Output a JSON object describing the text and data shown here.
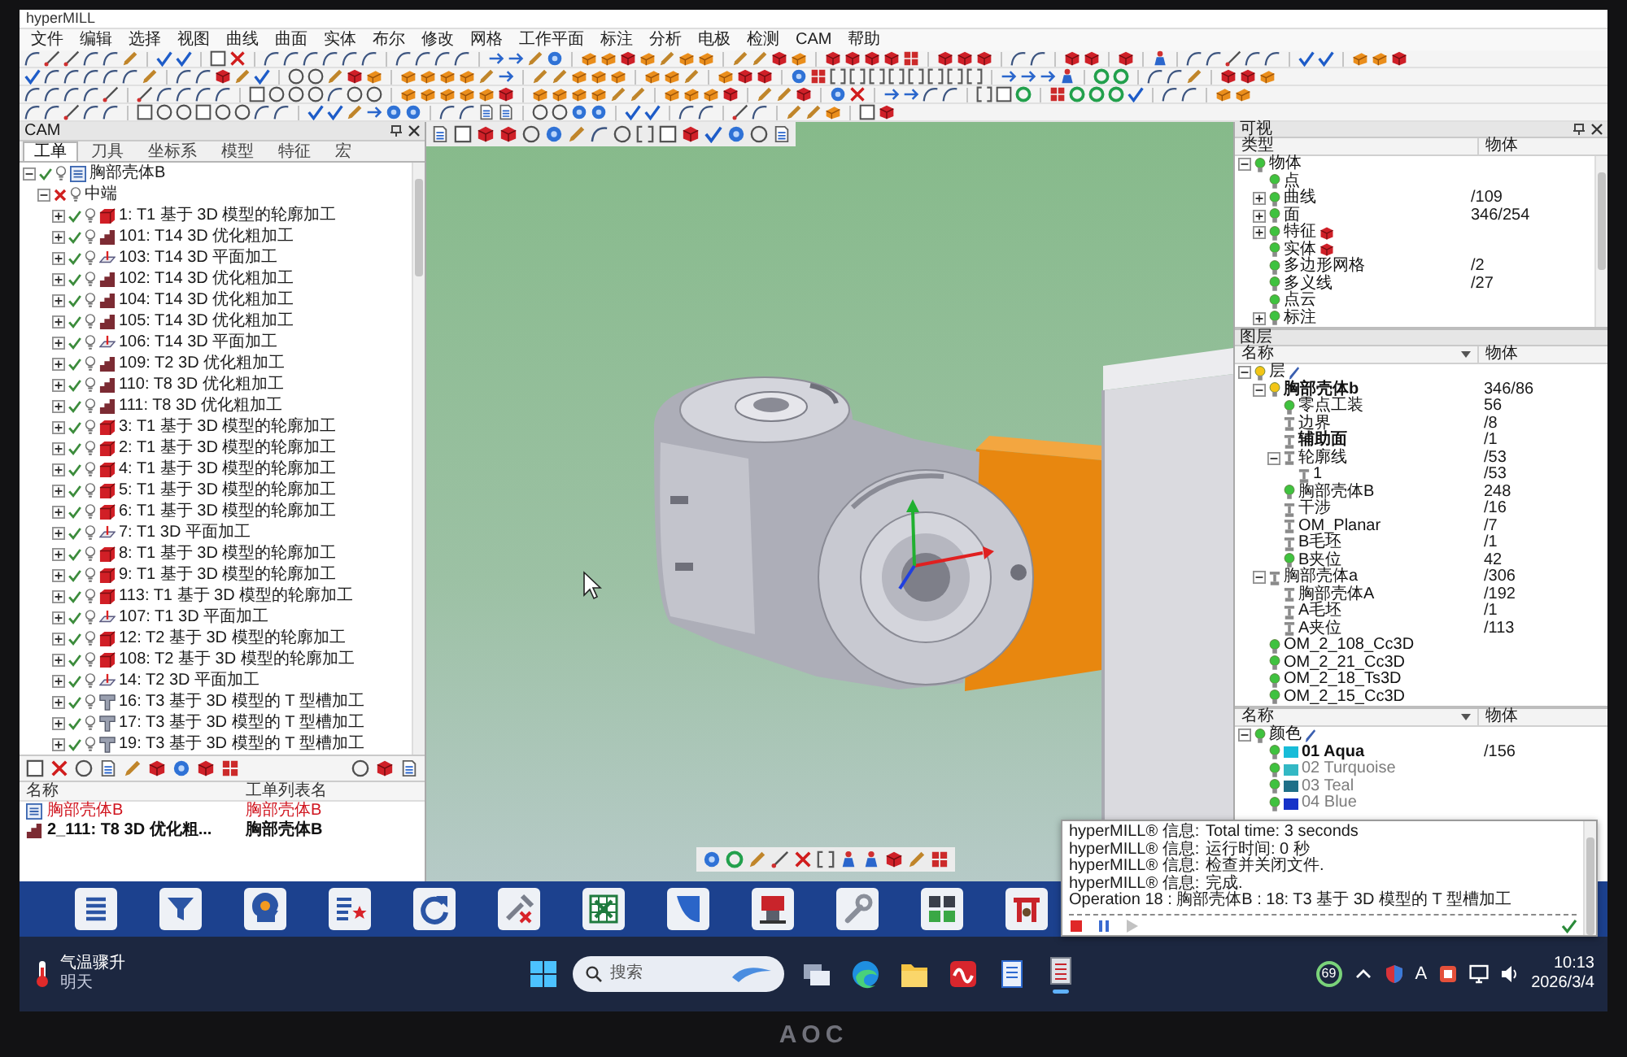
{
  "window": {
    "title": "hyperMILL"
  },
  "menu": [
    "文件",
    "编辑",
    "选择",
    "视图",
    "曲线",
    "曲面",
    "实体",
    "布尔",
    "修改",
    "网格",
    "工作平面",
    "标注",
    "分析",
    "电极",
    "检测",
    "CAM",
    "帮助"
  ],
  "cam_panel": {
    "title": "CAM",
    "tabs": [
      {
        "label": "工单",
        "selected": true
      },
      {
        "label": "刀具",
        "selected": false
      },
      {
        "label": "坐标系",
        "selected": false
      },
      {
        "label": "模型",
        "selected": false
      },
      {
        "label": "特征",
        "selected": false
      },
      {
        "label": "宏",
        "selected": false
      }
    ],
    "tree": {
      "label": "胸部壳体B",
      "kind": "job-list",
      "calculated": true,
      "expanded": true,
      "children": [
        {
          "label": "中端",
          "calculated": false,
          "expanded": true,
          "children": [
            {
              "label": "1: T1 基于 3D 模型的轮廓加工",
              "kind": "contour",
              "calculated": true,
              "expanded": false
            },
            {
              "label": "101: T14 3D 优化粗加工",
              "kind": "roughing",
              "calculated": true,
              "expanded": false
            },
            {
              "label": "103: T14 3D 平面加工",
              "kind": "plane",
              "calculated": true,
              "expanded": false
            },
            {
              "label": "102: T14 3D 优化粗加工",
              "kind": "roughing",
              "calculated": true,
              "expanded": false
            },
            {
              "label": "104: T14 3D 优化粗加工",
              "kind": "roughing",
              "calculated": true,
              "expanded": false
            },
            {
              "label": "105: T14 3D 优化粗加工",
              "kind": "roughing",
              "calculated": true,
              "expanded": false
            },
            {
              "label": "106: T14 3D 平面加工",
              "kind": "plane",
              "calculated": true,
              "expanded": false
            },
            {
              "label": "109: T2 3D 优化粗加工",
              "kind": "roughing",
              "calculated": true,
              "expanded": false
            },
            {
              "label": "110: T8 3D 优化粗加工",
              "kind": "roughing",
              "calculated": true,
              "expanded": false
            },
            {
              "label": "111: T8 3D 优化粗加工",
              "kind": "roughing",
              "calculated": true,
              "expanded": false
            },
            {
              "label": "3: T1 基于 3D 模型的轮廓加工",
              "kind": "contour",
              "calculated": true,
              "expanded": false
            },
            {
              "label": "2: T1 基于 3D 模型的轮廓加工",
              "kind": "contour",
              "calculated": true,
              "expanded": false
            },
            {
              "label": "4: T1 基于 3D 模型的轮廓加工",
              "kind": "contour",
              "calculated": true,
              "expanded": false
            },
            {
              "label": "5: T1 基于 3D 模型的轮廓加工",
              "kind": "contour",
              "calculated": true,
              "expanded": false
            },
            {
              "label": "6: T1 基于 3D 模型的轮廓加工",
              "kind": "contour",
              "calculated": true,
              "expanded": false
            },
            {
              "label": "7: T1 3D 平面加工",
              "kind": "plane",
              "calculated": true,
              "expanded": false
            },
            {
              "label": "8: T1 基于 3D 模型的轮廓加工",
              "kind": "contour",
              "calculated": true,
              "expanded": false
            },
            {
              "label": "9: T1 基于 3D 模型的轮廓加工",
              "kind": "contour",
              "calculated": true,
              "expanded": false
            },
            {
              "label": "113: T1 基于 3D 模型的轮廓加工",
              "kind": "contour",
              "calculated": true,
              "expanded": false
            },
            {
              "label": "107: T1 3D 平面加工",
              "kind": "plane",
              "calculated": true,
              "expanded": false
            },
            {
              "label": "12: T2 基于 3D 模型的轮廓加工",
              "kind": "contour",
              "calculated": true,
              "expanded": false
            },
            {
              "label": "108: T2 基于 3D 模型的轮廓加工",
              "kind": "contour",
              "calculated": true,
              "expanded": false
            },
            {
              "label": "14: T2 3D 平面加工",
              "kind": "plane",
              "calculated": true,
              "expanded": false
            },
            {
              "label": "16: T3 基于 3D 模型的 T 型槽加工",
              "kind": "tslot",
              "calculated": true,
              "expanded": false
            },
            {
              "label": "17: T3 基于 3D 模型的 T 型槽加工",
              "kind": "tslot",
              "calculated": true,
              "expanded": false
            },
            {
              "label": "19: T3 基于 3D 模型的 T 型槽加工",
              "kind": "tslot",
              "calculated": true,
              "expanded": false
            }
          ]
        }
      ]
    },
    "list": {
      "columns": [
        "名称",
        "工单列表名"
      ],
      "rows": [
        {
          "name": "胸部壳体B",
          "job_list": "胸部壳体B",
          "kind": "job-list",
          "highlighted": true
        },
        {
          "name": "2_111: T8 3D 优化粗...",
          "job_list": "胸部壳体B",
          "kind": "roughing",
          "highlighted": false
        }
      ]
    }
  },
  "visibility_panel": {
    "title": "可视",
    "columns": [
      "类型",
      "物体"
    ],
    "tree": {
      "label": "物体",
      "expanded": true,
      "children": [
        {
          "label": "点"
        },
        {
          "label": "曲线",
          "count": "/109",
          "expanded": false
        },
        {
          "label": "面",
          "count": "346/254",
          "expanded": false
        },
        {
          "label": "特征",
          "kind": "solid",
          "expanded": false
        },
        {
          "label": "实体",
          "kind": "solid"
        },
        {
          "label": "多边形网格",
          "count": "/2"
        },
        {
          "label": "多义线",
          "count": "/27"
        },
        {
          "label": "点云"
        },
        {
          "label": "标注",
          "expanded": false
        }
      ]
    }
  },
  "layer_panel": {
    "title": "图层",
    "columns": [
      "名称",
      "物体"
    ],
    "tree": {
      "label": "层",
      "expanded": true,
      "visible": true,
      "current": true,
      "highlighted": false,
      "children": [
        {
          "label": "胸部壳体b",
          "count": "346/86",
          "expanded": true,
          "visible": true,
          "current": true,
          "highlighted": true,
          "children": [
            {
              "label": "零点工装",
              "count": "56",
              "visible": true,
              "current": false,
              "highlighted": false
            },
            {
              "label": "边界",
              "count": "/8",
              "visible": false,
              "current": false,
              "highlighted": false
            },
            {
              "label": "辅助面",
              "count": "/1",
              "visible": false,
              "current": false,
              "highlighted": true
            },
            {
              "label": "轮廓线",
              "count": "/53",
              "expanded": true,
              "visible": false,
              "current": false,
              "highlighted": false,
              "children": [
                {
                  "label": "1",
                  "count": "/53",
                  "visible": false,
                  "current": false,
                  "highlighted": false
                }
              ]
            },
            {
              "label": "胸部壳体B",
              "count": "248",
              "visible": true,
              "current": false,
              "highlighted": false
            },
            {
              "label": "干涉",
              "count": "/16",
              "visible": false,
              "current": false,
              "highlighted": false
            },
            {
              "label": "OM_Planar",
              "count": "/7",
              "visible": false,
              "current": false,
              "highlighted": false
            },
            {
              "label": "B毛坯",
              "count": "/1",
              "visible": false,
              "current": false,
              "highlighted": false
            },
            {
              "label": "B夹位",
              "count": "42",
              "visible": true,
              "current": false,
              "highlighted": false
            }
          ]
        },
        {
          "label": "胸部壳体a",
          "count": "/306",
          "expanded": true,
          "visible": false,
          "current": false,
          "highlighted": false,
          "children": [
            {
              "label": "胸部壳体A",
              "count": "/192",
              "visible": false,
              "current": false,
              "highlighted": false
            },
            {
              "label": "A毛坯",
              "count": "/1",
              "visible": false,
              "current": false,
              "highlighted": false
            },
            {
              "label": "A夹位",
              "count": "/113",
              "visible": false,
              "current": false,
              "highlighted": false
            }
          ]
        },
        {
          "label": "OM_2_108_Cc3D",
          "visible": true,
          "current": false,
          "highlighted": false
        },
        {
          "label": "OM_2_21_Cc3D",
          "visible": true,
          "current": false,
          "highlighted": false
        },
        {
          "label": "OM_2_18_Ts3D",
          "visible": true,
          "current": false,
          "highlighted": false
        },
        {
          "label": "OM_2_15_Cc3D",
          "visible": true,
          "current": false,
          "highlighted": false
        }
      ]
    }
  },
  "color_panel": {
    "columns": [
      "名称",
      "物体"
    ],
    "tree": {
      "label": "颜色",
      "expanded": true,
      "visible": true,
      "highlighted": false,
      "children": [
        {
          "label": "01 Aqua",
          "count": "/156",
          "color": "#18bcd8",
          "visible": true,
          "highlighted": true
        },
        {
          "label": "02 Turquoise",
          "color": "#33b8c4",
          "visible": true,
          "highlighted": false
        },
        {
          "label": "03 Teal",
          "color": "#1f6f88",
          "visible": true,
          "highlighted": false
        },
        {
          "label": "04 Blue",
          "color": "#1632c8",
          "visible": true,
          "highlighted": false
        }
      ]
    }
  },
  "message_window": {
    "lines": [
      {
        "source": "hyperMILL® 信息:",
        "text": "Total time: 3 seconds"
      },
      {
        "source": "hyperMILL® 信息:",
        "text": "运行时间: 0 秒"
      },
      {
        "source": "hyperMILL® 信息:",
        "text": "检查并关闭文件."
      },
      {
        "source": "hyperMILL® 信息:",
        "text": "完成."
      }
    ],
    "operation": "Operation 18 : 胸部壳体B : 18: T3 基于 3D 模型的 T 型槽加工",
    "controls": [
      {
        "kind": "stop",
        "disabled": false
      },
      {
        "kind": "pause",
        "disabled": false
      },
      {
        "kind": "play",
        "disabled": true
      }
    ]
  },
  "taskbar": {
    "weather": {
      "headline": "气温骤升",
      "detail": "明天"
    },
    "search": {
      "placeholder": "搜索"
    },
    "apps": [
      {
        "kind": "task-view",
        "active": false
      },
      {
        "kind": "browser",
        "active": false
      },
      {
        "kind": "folder",
        "active": false
      },
      {
        "kind": "office",
        "active": false
      },
      {
        "kind": "notepad",
        "active": false
      },
      {
        "kind": "cam",
        "active": true
      }
    ],
    "tray": {
      "badge": "69",
      "input_method": "A",
      "time": "10:13",
      "date": "2026/3/4"
    }
  },
  "monitor": {
    "brand": "AOC"
  }
}
